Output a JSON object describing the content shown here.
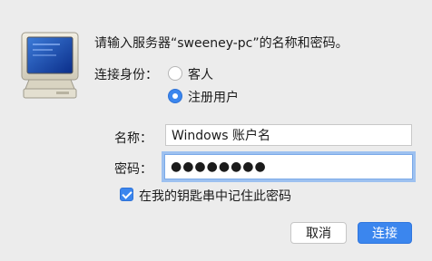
{
  "dialog": {
    "prompt": "请输入服务器“sweeney-pc”的名称和密码。",
    "connect_as_label": "连接身份：",
    "options": {
      "guest": "客人",
      "registered": "注册用户"
    },
    "name_label": "名称：",
    "name_value": "Windows 账户名",
    "password_label": "密码：",
    "password_value": "●●●●●●●●",
    "remember_label": "在我的钥匙串中记住此密码",
    "cancel_label": "取消",
    "connect_label": "连接"
  }
}
